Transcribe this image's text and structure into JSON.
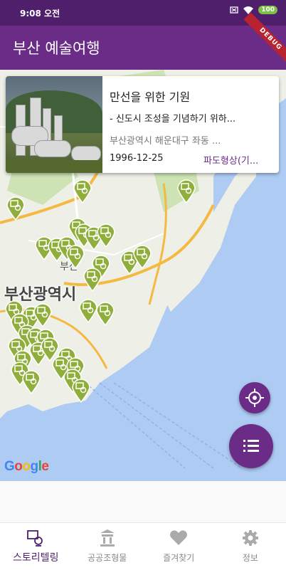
{
  "status": {
    "time": "9:08 오전",
    "battery": "100"
  },
  "appbar": {
    "title": "부산 예술여행",
    "debug_label": "DEBUG"
  },
  "card": {
    "title": "만선을 위한 기원",
    "description": "- 신도시 조성을 기념하기 위하...",
    "address": "부산광역시 해운대구 좌동 ...",
    "date": "1996-12-25",
    "category": "파도형상(기..."
  },
  "map": {
    "city_label": "부산광역시",
    "district_label": "부산",
    "attribution": "Google",
    "colors": {
      "water": "#aecbf3",
      "land": "#eef0e8",
      "marker": "#8fae3b",
      "road": "#f4b942"
    }
  },
  "fab": {
    "locate_icon": "crosshair-icon",
    "list_icon": "list-icon"
  },
  "tabs": [
    {
      "label": "스토리텔링",
      "icon": "storytelling-icon",
      "active": true
    },
    {
      "label": "공공조형물",
      "icon": "monument-icon",
      "active": false
    },
    {
      "label": "즐겨찾기",
      "icon": "heart-icon",
      "active": false
    },
    {
      "label": "정보",
      "icon": "gear-icon",
      "active": false
    }
  ],
  "theme": {
    "primary": "#6a2c86",
    "primary_dark": "#4f1f6b"
  }
}
